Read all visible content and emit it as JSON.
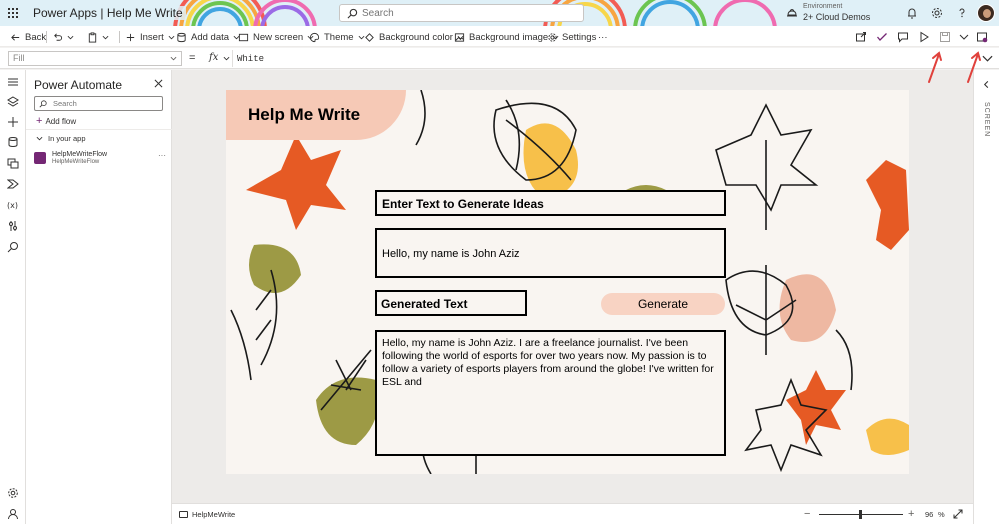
{
  "titlebar": {
    "app_title": "Power Apps  |  Help Me Write",
    "search_placeholder": "Search",
    "environment_label": "Environment",
    "environment_name": "2+ Cloud Demos"
  },
  "commandbar": {
    "back": "Back",
    "insert": "Insert",
    "add_data": "Add data",
    "new_screen": "New screen",
    "theme": "Theme",
    "background_color": "Background color",
    "background_image": "Background image",
    "settings": "Settings",
    "more": "···"
  },
  "formulabar": {
    "property": "Fill",
    "equals": "=",
    "fx": "fx",
    "formula": "White"
  },
  "pane": {
    "title": "Power Automate",
    "search_placeholder": "Search",
    "add_flow": "Add flow",
    "section": "In your app",
    "flow_name": "HelpMeWriteFlow",
    "flow_sub": "HelpMeWriteFlow",
    "flow_more": "···"
  },
  "app_screen": {
    "heading": "Help Me Write",
    "enter_label": "Enter Text to Generate Ideas",
    "input_text": "Hello, my name is John Aziz",
    "generated_label": "Generated Text",
    "generate_button": "Generate",
    "output_text": "Hello, my name is John Aziz. I are a freelance journalist. I've been following the world of esports for over two years now. My passion is to follow a variety of esports players from around the globe! I've written for ESL and"
  },
  "rightrail": {
    "label": "SCREEN"
  },
  "statusbar": {
    "screen_name": "HelpMeWrite",
    "zoom_minus": "−",
    "zoom_plus": "+",
    "zoom_value": "96",
    "zoom_unit": "%"
  },
  "colors": {
    "accent": "#742774",
    "annotation_arrow": "#e0413c",
    "button_fill": "#f8d3c3",
    "screen_bg": "#f9f5f1"
  }
}
